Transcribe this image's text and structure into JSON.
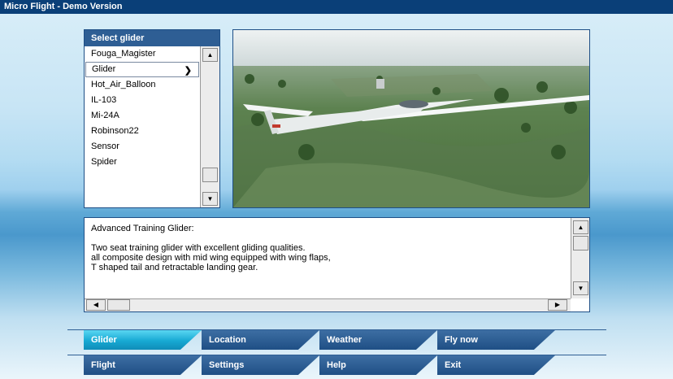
{
  "window": {
    "title": "Micro Flight - Demo Version"
  },
  "glider_list": {
    "header": "Select glider",
    "items": [
      {
        "label": "Fouga_Magister"
      },
      {
        "label": "Glider"
      },
      {
        "label": "Hot_Air_Balloon"
      },
      {
        "label": "IL-103"
      },
      {
        "label": "Mi-24A"
      },
      {
        "label": "Robinson22"
      },
      {
        "label": "Sensor"
      },
      {
        "label": "Spider"
      }
    ],
    "selected": "Glider"
  },
  "description": {
    "lines": [
      "Advanced Training Glider:",
      "",
      "Two seat training glider with excellent gliding qualities.",
      "all composite design with mid wing equipped with wing flaps,",
      "T shaped tail and retractable landing gear."
    ]
  },
  "menu": {
    "row1": [
      {
        "label": "Glider",
        "active": true
      },
      {
        "label": "Location",
        "active": false
      },
      {
        "label": "Weather",
        "active": false
      },
      {
        "label": "Fly now",
        "active": false
      }
    ],
    "row2": [
      {
        "label": "Flight",
        "active": false
      },
      {
        "label": "Settings",
        "active": false
      },
      {
        "label": "Help",
        "active": false
      },
      {
        "label": "Exit",
        "active": false
      }
    ]
  },
  "colors": {
    "titlebar": "#0a3f78",
    "menu_button": "#2e5e94",
    "menu_active": "#17a9d3"
  }
}
